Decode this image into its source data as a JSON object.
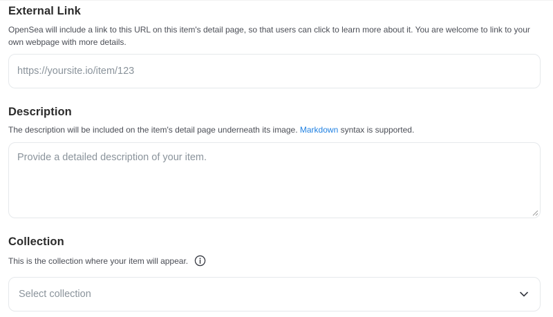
{
  "external_link": {
    "title": "External Link",
    "description": "OpenSea will include a link to this URL on this item's detail page, so that users can click to learn more about it. You are welcome to link to your own webpage with more details.",
    "placeholder": "https://yoursite.io/item/123",
    "value": ""
  },
  "description": {
    "title": "Description",
    "help_before": "The description will be included on the item's detail page underneath its image.",
    "help_link": "Markdown",
    "help_after": "syntax is supported.",
    "placeholder": "Provide a detailed description of your item.",
    "value": ""
  },
  "collection": {
    "title": "Collection",
    "help": "This is the collection where your item will appear.",
    "info_icon": "info-circle-icon",
    "select_placeholder": "Select collection",
    "chevron_icon": "chevron-down-icon"
  },
  "colors": {
    "link": "#2081e2",
    "border": "#e5e8eb",
    "placeholder": "#8a939b"
  }
}
